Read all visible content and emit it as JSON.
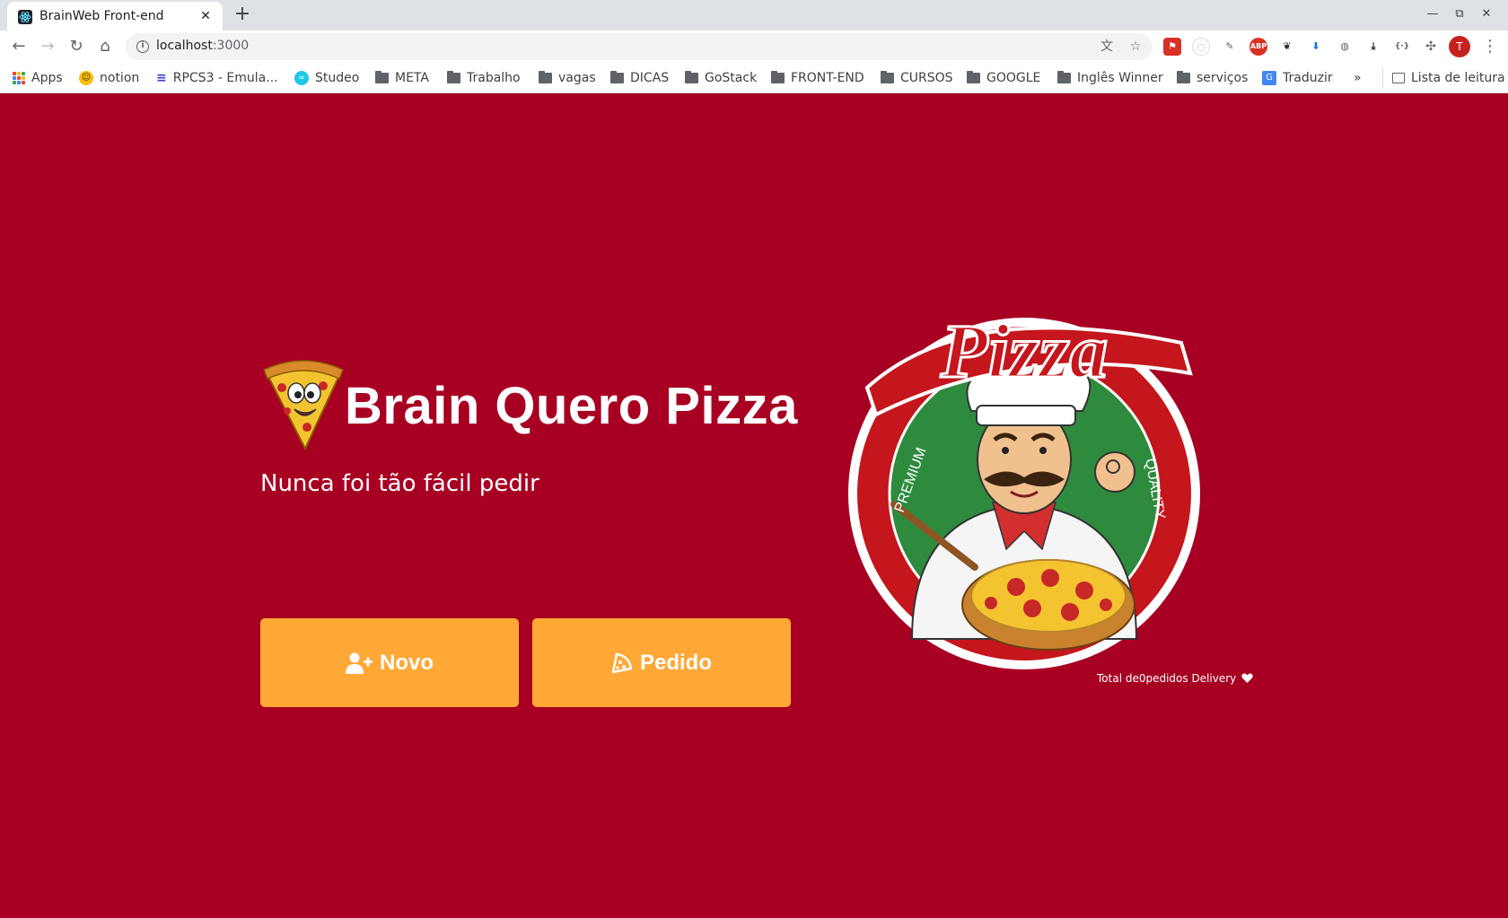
{
  "browser": {
    "tab": {
      "title": "BrainWeb Front-end",
      "close": "✕"
    },
    "new_tab": "+",
    "window_controls": {
      "minimize": "—",
      "restore": "⧉",
      "close": "✕"
    },
    "nav": {
      "back": "←",
      "forward": "→",
      "reload": "↻",
      "home": "⌂"
    },
    "url": {
      "host": "localhost",
      "port": ":3000"
    },
    "profile_initial": "T",
    "bookmarks": [
      {
        "label": "Apps",
        "icon": "apps-grid-icon"
      },
      {
        "label": "notion",
        "icon": "notion-smiley-icon"
      },
      {
        "label": "RPCS3 - Emula...",
        "icon": "rpcs3-icon"
      },
      {
        "label": "Studeo",
        "icon": "studeo-icon"
      },
      {
        "label": "META",
        "icon": "folder-icon"
      },
      {
        "label": "Trabalho",
        "icon": "folder-icon"
      },
      {
        "label": "vagas",
        "icon": "folder-icon"
      },
      {
        "label": "DICAS",
        "icon": "folder-icon"
      },
      {
        "label": "GoStack",
        "icon": "folder-icon"
      },
      {
        "label": "FRONT-END",
        "icon": "folder-icon"
      },
      {
        "label": "CURSOS",
        "icon": "folder-icon"
      },
      {
        "label": "GOOGLE",
        "icon": "folder-icon"
      },
      {
        "label": "Inglês Winner",
        "icon": "folder-icon"
      },
      {
        "label": "serviços",
        "icon": "folder-icon"
      },
      {
        "label": "Traduzir",
        "icon": "google-translate-icon"
      }
    ],
    "bookmarks_overflow": "»",
    "reading_list": "Lista de leitura"
  },
  "page": {
    "title": "Brain Quero Pizza",
    "subtitle": "Nunca foi tão fácil pedir",
    "buttons": {
      "novo": "Novo",
      "pedido": "Pedido"
    },
    "footer_note": "Total de0pedidos Delivery",
    "colors": {
      "background": "#a70022",
      "button": "#ffa836",
      "text": "#ffffff"
    }
  }
}
